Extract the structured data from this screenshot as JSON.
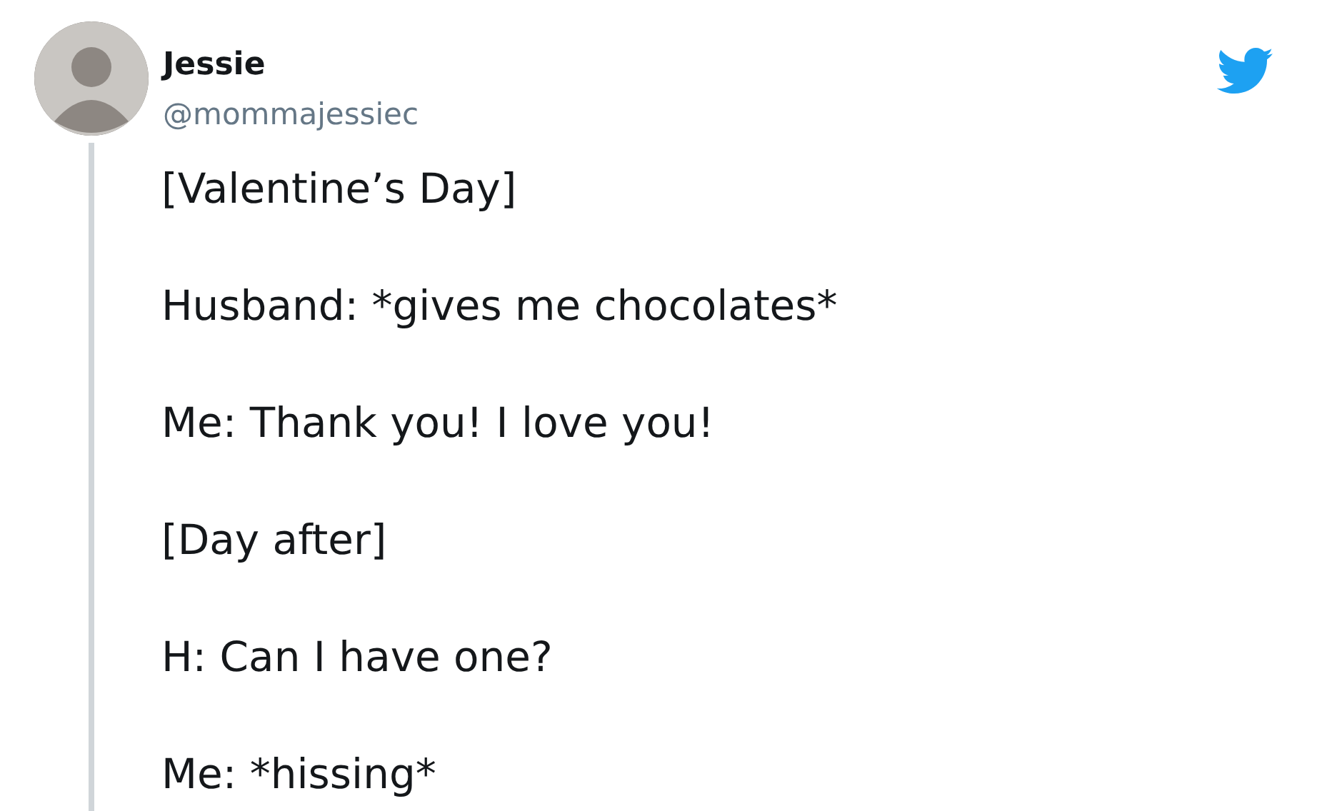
{
  "author": {
    "name": "Jessie",
    "handle": "@mommajessiec"
  },
  "lines": [
    "[Valentine’s Day]",
    "Husband: *gives me chocolates*",
    "Me: Thank you! I love you!",
    "[Day after]",
    "H: Can I have one?",
    "Me: *hissing*"
  ]
}
